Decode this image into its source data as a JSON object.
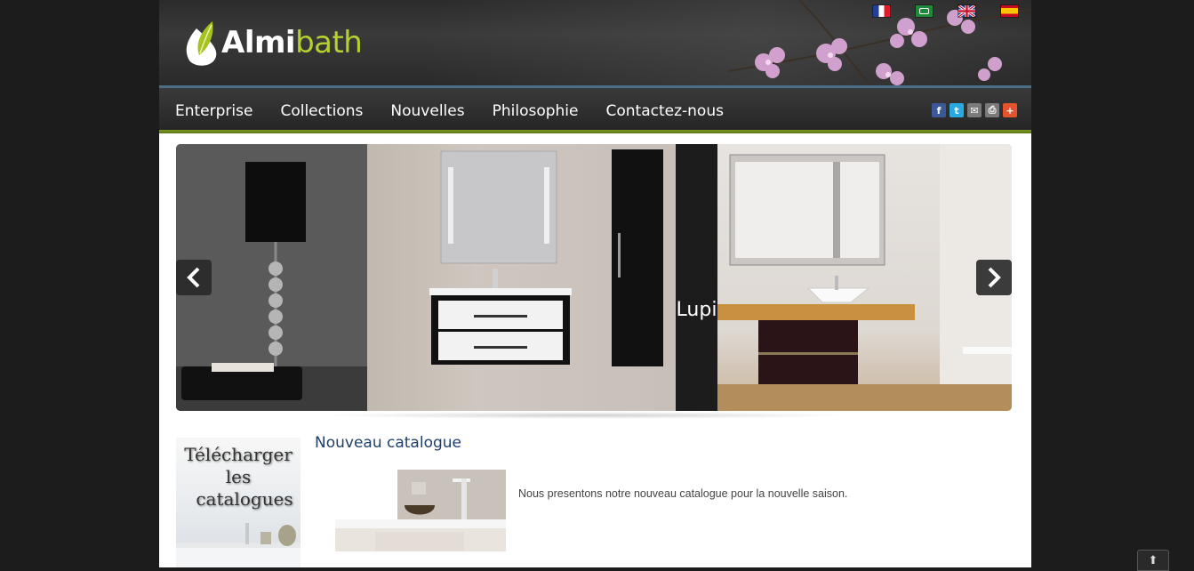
{
  "brand": {
    "logo_part1": "Almi",
    "logo_part2": "bath",
    "accent_green": "#b7cf2f",
    "nav_accent_blue": "#4a6f86"
  },
  "languages": [
    {
      "name": "français",
      "icon": "flag-fr-icon"
    },
    {
      "name": "العربية",
      "icon": "flag-ar-icon"
    },
    {
      "name": "English",
      "icon": "flag-en-icon"
    },
    {
      "name": "español",
      "icon": "flag-es-icon"
    }
  ],
  "nav": {
    "items": [
      "Enterprise",
      "Collections",
      "Nouvelles",
      "Philosophie",
      "Contactez-nous"
    ]
  },
  "social": [
    {
      "icon": "facebook-icon",
      "glyph": "f",
      "color": "#3b5998"
    },
    {
      "icon": "twitter-icon",
      "glyph": "t",
      "color": "#2aa9e0"
    },
    {
      "icon": "email-icon",
      "glyph": "✉",
      "color": "#7a7a7a"
    },
    {
      "icon": "print-icon",
      "glyph": "⎙",
      "color": "#7a7a7a"
    },
    {
      "icon": "share-plus-icon",
      "glyph": "+",
      "color": "#e5532e"
    }
  ],
  "slider": {
    "caption": "Lupi",
    "prev_icon": "chevron-left-icon",
    "next_icon": "chevron-right-icon"
  },
  "catalog_box": {
    "line1": "Télécharger",
    "line2": "les",
    "line3": "catalogues"
  },
  "news": {
    "title": "Nouveau catalogue",
    "text": "Nous presentons notre nouveau catalogue pour la nouvelle saison."
  },
  "scroll_top": {
    "glyph": "⬆",
    "icon": "arrow-up-icon"
  }
}
